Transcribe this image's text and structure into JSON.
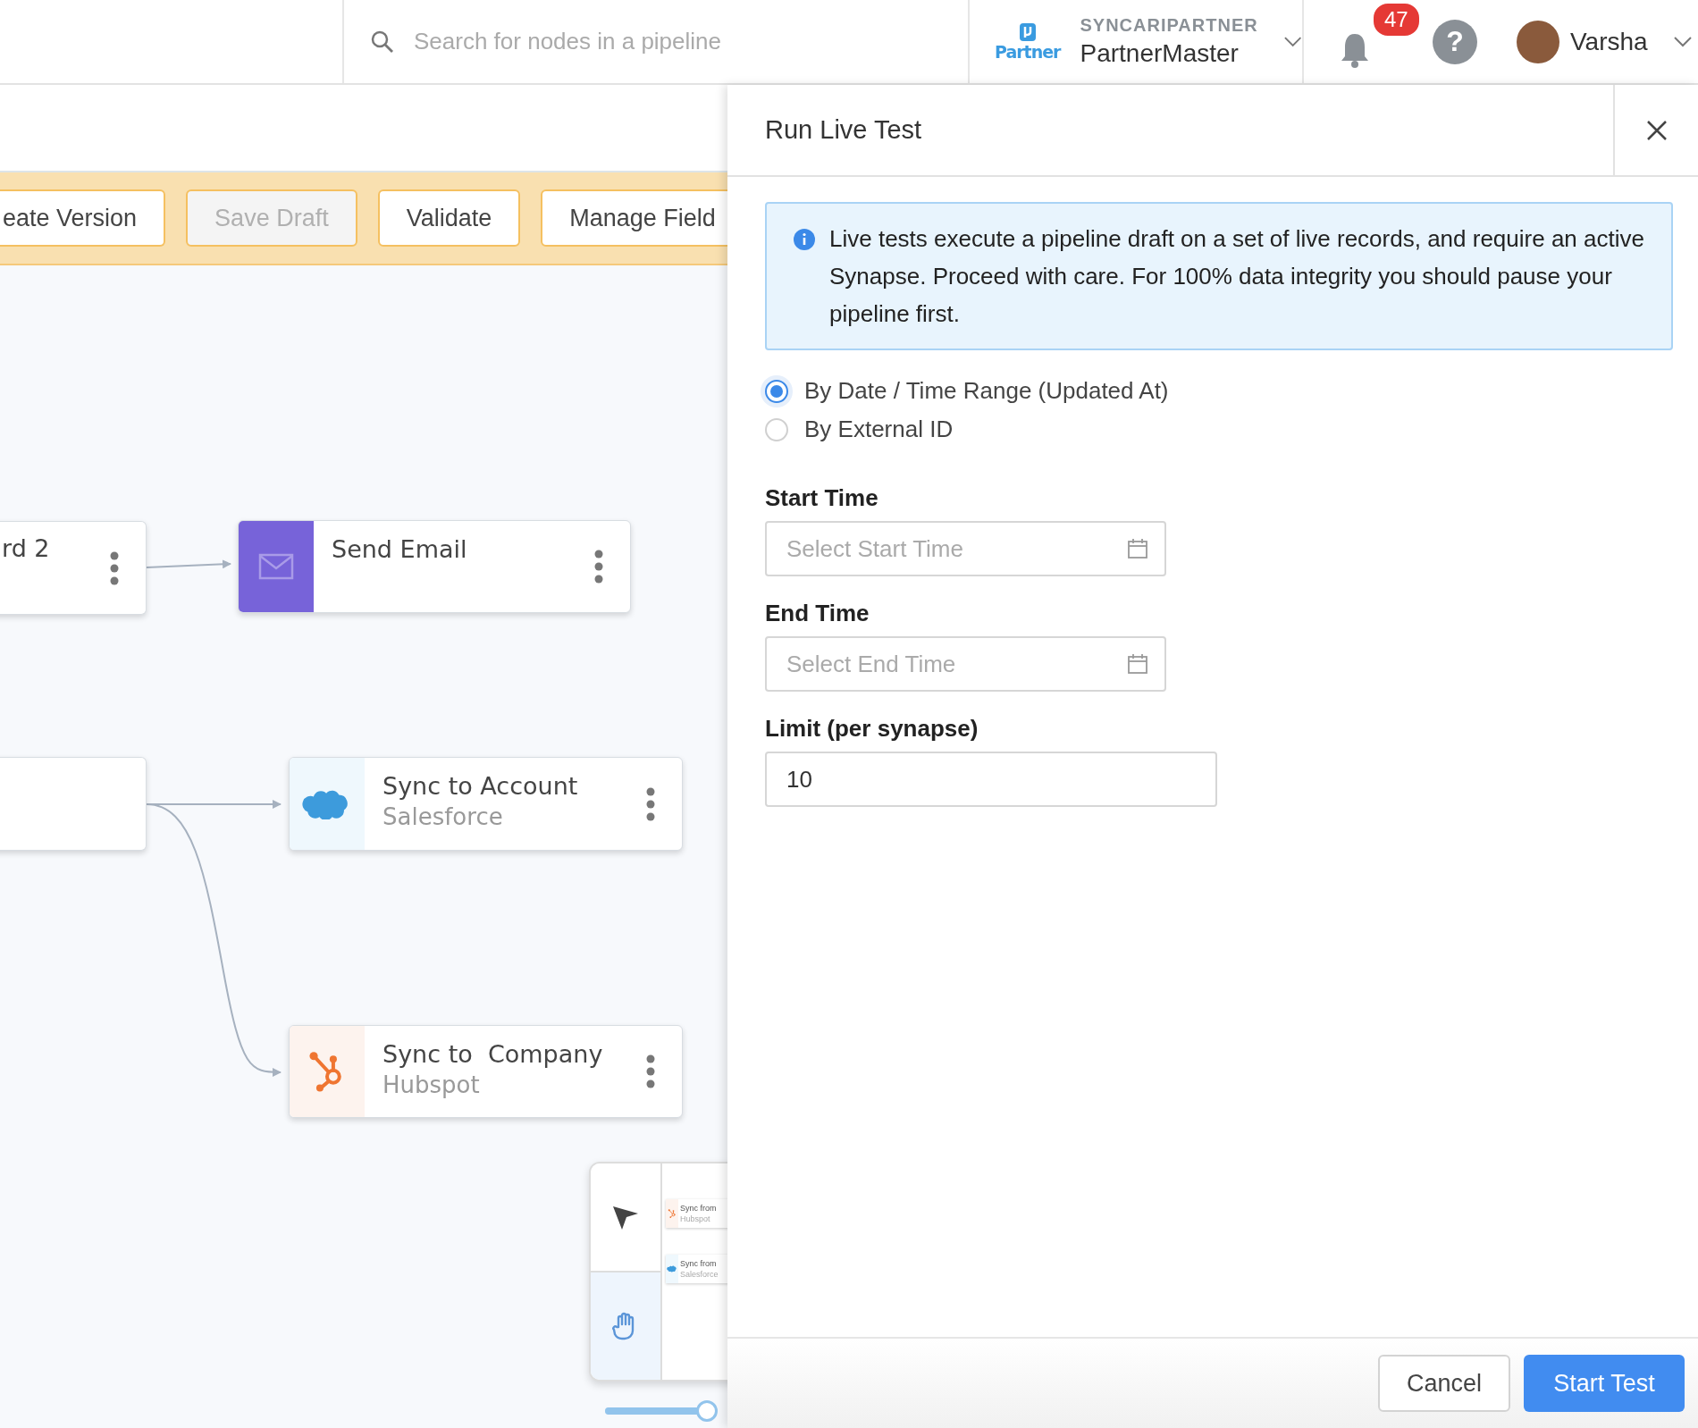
{
  "topbar": {
    "search": {
      "placeholder": "Search for nodes in a pipeline"
    },
    "org": {
      "logo_text": "Partner",
      "name": "SYNCARIPARTNER",
      "account": "PartnerMaster"
    },
    "notifications": {
      "count": "47"
    },
    "help": {
      "glyph": "?"
    },
    "user": {
      "name": "Varsha"
    }
  },
  "toolbar": {
    "buttons": [
      {
        "label": "eate Version",
        "disabled": false
      },
      {
        "label": "Save Draft",
        "disabled": true
      },
      {
        "label": "Validate",
        "disabled": false
      },
      {
        "label": "Manage Field",
        "disabled": false
      }
    ]
  },
  "canvas": {
    "nodes": [
      {
        "kind": "plain",
        "title": "rd 2"
      },
      {
        "kind": "email",
        "title": "Send Email"
      },
      {
        "kind": "plain"
      },
      {
        "kind": "salesforce",
        "title": "Sync to Account",
        "subtitle": "Salesforce"
      },
      {
        "kind": "hubspot",
        "title": "Sync to  Company",
        "subtitle": "Hubspot"
      }
    ],
    "zoom": {
      "level": 0.95
    },
    "minimap": {
      "tools": [
        {
          "kind": "pointer",
          "selected": false
        },
        {
          "kind": "hand",
          "selected": true
        }
      ],
      "nodes": [
        {
          "kind": "hubspot",
          "title": "Sync from",
          "subtitle": "Hubspot"
        },
        {
          "kind": "salesforce",
          "title": "Sync from",
          "subtitle": "Salesforce"
        }
      ]
    }
  },
  "panel": {
    "title": "Run Live Test",
    "info": "Live tests execute a pipeline draft on a set of live records, and require an active Synapse. Proceed with care. For 100% data integrity you should pause your pipeline first.",
    "options": [
      {
        "label": "By Date / Time Range (Updated At)",
        "selected": true
      },
      {
        "label": "By External ID",
        "selected": false
      }
    ],
    "fields": [
      {
        "kind": "date",
        "label": "Start Time",
        "placeholder": "Select Start Time"
      },
      {
        "kind": "date",
        "label": "End Time",
        "placeholder": "Select End Time"
      },
      {
        "kind": "number",
        "label": "Limit (per synapse)",
        "value": "10"
      }
    ],
    "buttons": [
      {
        "kind": "secondary",
        "label": "Cancel"
      },
      {
        "kind": "primary",
        "label": "Start Test"
      }
    ]
  }
}
